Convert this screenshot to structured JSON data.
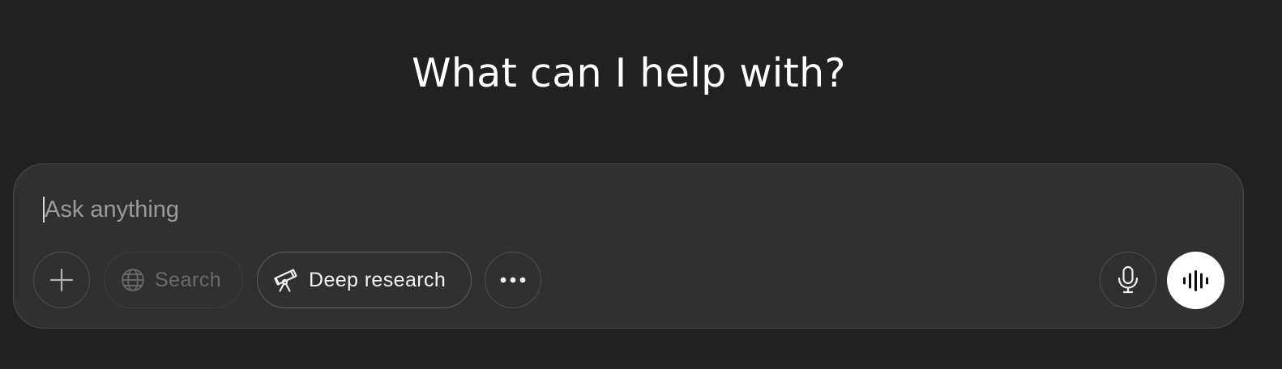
{
  "heading": "What can I help with?",
  "composer": {
    "placeholder": "Ask anything",
    "value": ""
  },
  "toolbar": {
    "add_icon": "plus-icon",
    "search": {
      "label": "Search",
      "icon": "globe-icon",
      "enabled": false
    },
    "deep_research": {
      "label": "Deep research",
      "icon": "telescope-icon"
    },
    "more_icon": "ellipsis-icon",
    "dictate_icon": "microphone-icon",
    "voice_mode_icon": "soundwave-icon"
  },
  "colors": {
    "background": "#212121",
    "composer": "#303030",
    "voice_button": "#ffffff"
  }
}
